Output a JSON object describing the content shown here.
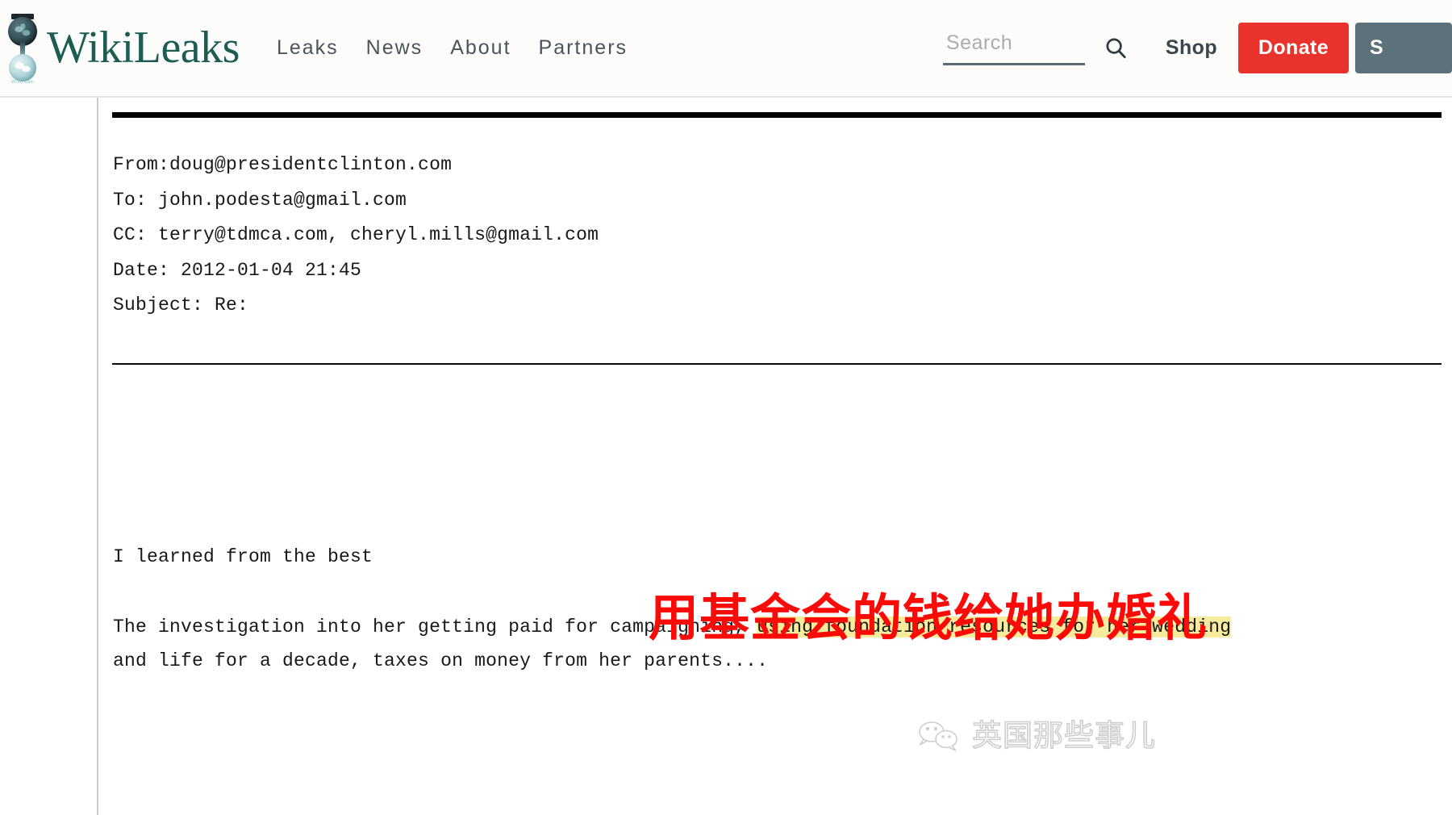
{
  "header": {
    "logo_word": "WikiLeaks",
    "logo_icon": "wikileaks-hourglass-logo",
    "logo_base_text": "WikiLeaks",
    "nav": [
      {
        "label": "Leaks"
      },
      {
        "label": "News"
      },
      {
        "label": "About"
      },
      {
        "label": "Partners"
      }
    ],
    "search": {
      "placeholder": "Search",
      "value": "",
      "icon": "search-icon"
    },
    "shop_label": "Shop",
    "donate_label": "Donate",
    "submit_label": "S",
    "colors": {
      "donate_red": "#e8322b",
      "submit_slate": "#5d717b",
      "logo_green": "#1d5c52",
      "nav_gray": "#4b5457"
    }
  },
  "email": {
    "headers": [
      "From:doug@presidentclinton.com",
      "To: john.podesta@gmail.com",
      "CC: terry@tdmca.com, cheryl.mills@gmail.com",
      "Date: 2012-01-04 21:45",
      "Subject: Re:"
    ],
    "body": {
      "line_1": "I learned from the best",
      "para_1_pre": "The investigation into her getting paid for campaigning, ",
      "para_1_highlight": "using foundation resources for her wedding",
      "para_1_post": "",
      "para_2": "and life for a decade, taxes on money from her parents...."
    }
  },
  "overlays": {
    "red_annotation": "用基金会的钱给她办婚礼",
    "red_annotation_color": "#fb0b08",
    "highlight_color": "#f7ec9e",
    "watermark_text": "英国那些事儿",
    "watermark_icon": "wechat-icon"
  }
}
